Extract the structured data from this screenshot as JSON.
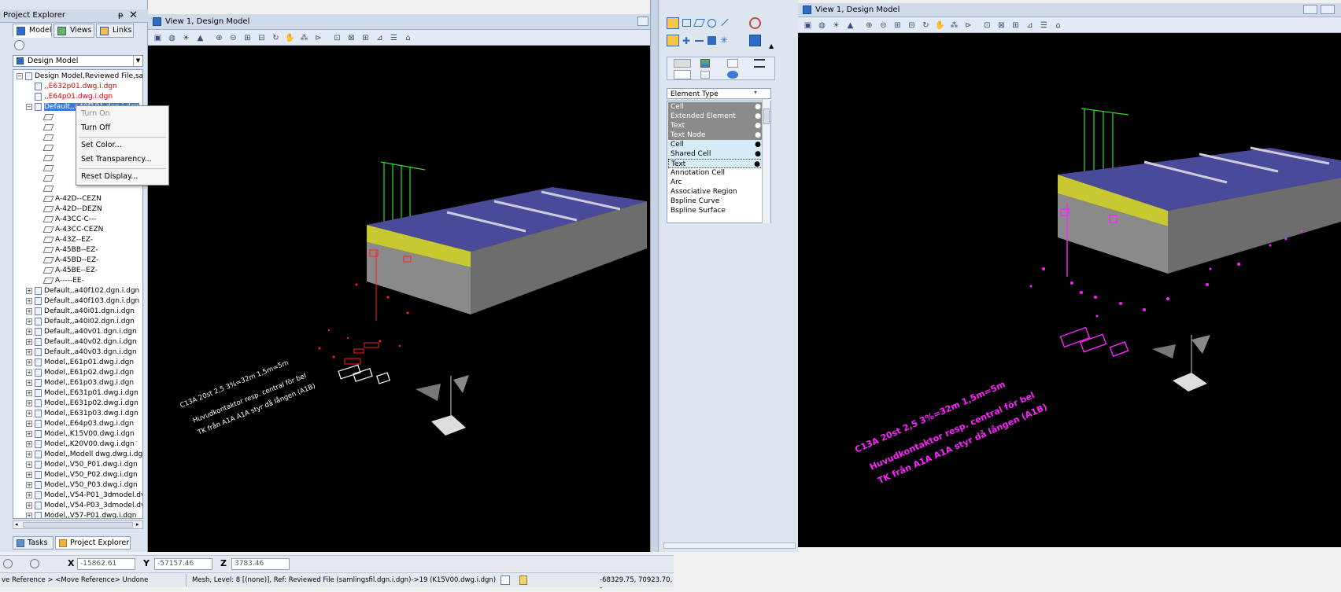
{
  "project_explorer": {
    "title": "Project Explorer",
    "pin_glyph": "ᵽ",
    "close_glyph": "✕",
    "tabs": [
      {
        "label": "Model",
        "active": true
      },
      {
        "label": "Views",
        "active": false
      },
      {
        "label": "Links",
        "active": false
      }
    ],
    "dropdown_value": "Design Model",
    "tree": [
      {
        "label": "Design Model,Reviewed File,sam",
        "type": "folder",
        "exp": "−",
        "indent": 0,
        "style": ""
      },
      {
        "label": ",,E632p01.dwg.i.dgn",
        "type": "file",
        "exp": "",
        "indent": 1,
        "style": "red"
      },
      {
        "label": ",,E64p01.dwg.i.dgn",
        "type": "file",
        "exp": "",
        "indent": 1,
        "style": "red"
      },
      {
        "label": "Default,,a40f101.dgn.i.dgn",
        "type": "folder",
        "exp": "−",
        "indent": 1,
        "style": "sel"
      },
      {
        "label": "",
        "type": "layer",
        "exp": "",
        "indent": 2,
        "style": ""
      },
      {
        "label": "",
        "type": "layer",
        "exp": "",
        "indent": 2,
        "style": ""
      },
      {
        "label": "",
        "type": "layer",
        "exp": "",
        "indent": 2,
        "style": ""
      },
      {
        "label": "",
        "type": "layer",
        "exp": "",
        "indent": 2,
        "style": ""
      },
      {
        "label": "",
        "type": "layer",
        "exp": "",
        "indent": 2,
        "style": ""
      },
      {
        "label": "",
        "type": "layer",
        "exp": "",
        "indent": 2,
        "style": ""
      },
      {
        "label": "",
        "type": "layer",
        "exp": "",
        "indent": 2,
        "style": ""
      },
      {
        "label": "",
        "type": "layer",
        "exp": "",
        "indent": 2,
        "style": ""
      },
      {
        "label": "A-42D--CEZN",
        "type": "layer",
        "exp": "",
        "indent": 2,
        "style": ""
      },
      {
        "label": "A-42D--DEZN",
        "type": "layer",
        "exp": "",
        "indent": 2,
        "style": ""
      },
      {
        "label": "A-43CC-C---",
        "type": "layer",
        "exp": "",
        "indent": 2,
        "style": ""
      },
      {
        "label": "A-43CC-CEZN",
        "type": "layer",
        "exp": "",
        "indent": 2,
        "style": ""
      },
      {
        "label": "A-43Z--EZ-",
        "type": "layer",
        "exp": "",
        "indent": 2,
        "style": ""
      },
      {
        "label": "A-45BB--EZ-",
        "type": "layer",
        "exp": "",
        "indent": 2,
        "style": ""
      },
      {
        "label": "A-45BD--EZ-",
        "type": "layer",
        "exp": "",
        "indent": 2,
        "style": ""
      },
      {
        "label": "A-45BE--EZ-",
        "type": "layer",
        "exp": "",
        "indent": 2,
        "style": ""
      },
      {
        "label": "A-----EE-",
        "type": "layer",
        "exp": "",
        "indent": 2,
        "style": ""
      },
      {
        "label": "Default,,a40f102.dgn.i.dgn",
        "type": "folder",
        "exp": "+",
        "indent": 1,
        "style": ""
      },
      {
        "label": "Default,,a40f103.dgn.i.dgn",
        "type": "folder",
        "exp": "+",
        "indent": 1,
        "style": ""
      },
      {
        "label": "Default,,a40i01.dgn.i.dgn",
        "type": "folder",
        "exp": "+",
        "indent": 1,
        "style": ""
      },
      {
        "label": "Default,,a40i02.dgn.i.dgn",
        "type": "folder",
        "exp": "+",
        "indent": 1,
        "style": ""
      },
      {
        "label": "Default,,a40v01.dgn.i.dgn",
        "type": "folder",
        "exp": "+",
        "indent": 1,
        "style": ""
      },
      {
        "label": "Default,,a40v02.dgn.i.dgn",
        "type": "folder",
        "exp": "+",
        "indent": 1,
        "style": ""
      },
      {
        "label": "Default,,a40v03.dgn.i.dgn",
        "type": "folder",
        "exp": "+",
        "indent": 1,
        "style": ""
      },
      {
        "label": "Model,,E61p01.dwg.i.dgn",
        "type": "folder",
        "exp": "+",
        "indent": 1,
        "style": ""
      },
      {
        "label": "Model,,E61p02.dwg.i.dgn",
        "type": "folder",
        "exp": "+",
        "indent": 1,
        "style": ""
      },
      {
        "label": "Model,,E61p03.dwg.i.dgn",
        "type": "folder",
        "exp": "+",
        "indent": 1,
        "style": ""
      },
      {
        "label": "Model,,E631p01.dwg.i.dgn",
        "type": "folder",
        "exp": "+",
        "indent": 1,
        "style": ""
      },
      {
        "label": "Model,,E631p02.dwg.i.dgn",
        "type": "folder",
        "exp": "+",
        "indent": 1,
        "style": ""
      },
      {
        "label": "Model,,E631p03.dwg.i.dgn",
        "type": "folder",
        "exp": "+",
        "indent": 1,
        "style": ""
      },
      {
        "label": "Model,,E64p03.dwg.i.dgn",
        "type": "folder",
        "exp": "+",
        "indent": 1,
        "style": ""
      },
      {
        "label": "Model,,K15V00.dwg.i.dgn",
        "type": "folder",
        "exp": "+",
        "indent": 1,
        "style": ""
      },
      {
        "label": "Model,,K20V00.dwg.i.dgn",
        "type": "folder",
        "exp": "+",
        "indent": 1,
        "style": ""
      },
      {
        "label": "Model,,Modell dwg.dwg.i.dgr",
        "type": "folder",
        "exp": "+",
        "indent": 1,
        "style": ""
      },
      {
        "label": "Model,,V50_P01.dwg.i.dgn",
        "type": "folder",
        "exp": "+",
        "indent": 1,
        "style": ""
      },
      {
        "label": "Model,,V50_P02.dwg.i.dgn",
        "type": "folder",
        "exp": "+",
        "indent": 1,
        "style": ""
      },
      {
        "label": "Model,,V50_P03.dwg.i.dgn",
        "type": "folder",
        "exp": "+",
        "indent": 1,
        "style": ""
      },
      {
        "label": "Model,,V54-P01_3dmodel.dv",
        "type": "folder",
        "exp": "+",
        "indent": 1,
        "style": ""
      },
      {
        "label": "Model,,V54-P03_3dmodel.dv",
        "type": "folder",
        "exp": "+",
        "indent": 1,
        "style": ""
      },
      {
        "label": "Model,,V57-P01.dwg.i.dgn",
        "type": "folder",
        "exp": "+",
        "indent": 1,
        "style": ""
      }
    ],
    "bottom_tabs": [
      {
        "label": "Tasks",
        "active": false
      },
      {
        "label": "Project Explorer",
        "active": true
      }
    ]
  },
  "context_menu": {
    "items": [
      "Turn On",
      "Turn Off",
      "Set Color...",
      "Set Transparency...",
      "Reset Display..."
    ]
  },
  "view_left": {
    "title": "View 1, Design Model"
  },
  "view_right": {
    "title": "View 1, Design Model"
  },
  "element_selection": {
    "list_header": "Element Type",
    "items": [
      {
        "label": "Cell",
        "style": "dark",
        "dot": "●"
      },
      {
        "label": "Extended Element",
        "style": "dark",
        "dot": "●"
      },
      {
        "label": "Text",
        "style": "dark",
        "dot": "●"
      },
      {
        "label": "Text Node",
        "style": "dark",
        "dot": "●"
      },
      {
        "label": "Cell",
        "style": "light",
        "dot": "●"
      },
      {
        "label": "Shared Cell",
        "style": "light",
        "dot": "●"
      },
      {
        "label": "Text",
        "style": "boxed",
        "dot": "●"
      },
      {
        "label": "Annotation Cell",
        "style": "",
        "dot": ""
      },
      {
        "label": "Arc",
        "style": "",
        "dot": ""
      },
      {
        "label": "Associative Region",
        "style": "",
        "dot": ""
      },
      {
        "label": "Bspline Curve",
        "style": "",
        "dot": ""
      },
      {
        "label": "Bspline Surface",
        "style": "",
        "dot": ""
      }
    ]
  },
  "coords": {
    "x_label": "X",
    "x_value": "-15862.61",
    "y_label": "Y",
    "y_value": "-57157.46",
    "z_label": "Z",
    "z_value": "3783.46"
  },
  "status": {
    "left": "ve Reference > <Move Reference> Undone",
    "mid": "Mesh, Level: 8 [(none)], Ref: Reviewed File (samlingsfil.dgn.i.dgn)->19 (K15V00.dwg.i.dgn)",
    "right": "-68329.75, 70923.70, -"
  },
  "annotations": {
    "line1": "C13A 20st  2,5  3%=32m 1,5m=5m",
    "line2": "Huvudkontaktor  resp.  central för bel",
    "line3": "TK från A1A  A1A styr  då lången (A1B)"
  },
  "colors": {
    "accent": "#3b78d8",
    "roof": "#4a4a9a",
    "stripe": "#c8c832",
    "wall": "#8a8a8a",
    "green": "#33dd33",
    "red": "#ff2020",
    "magenta": "#ff22ff"
  }
}
